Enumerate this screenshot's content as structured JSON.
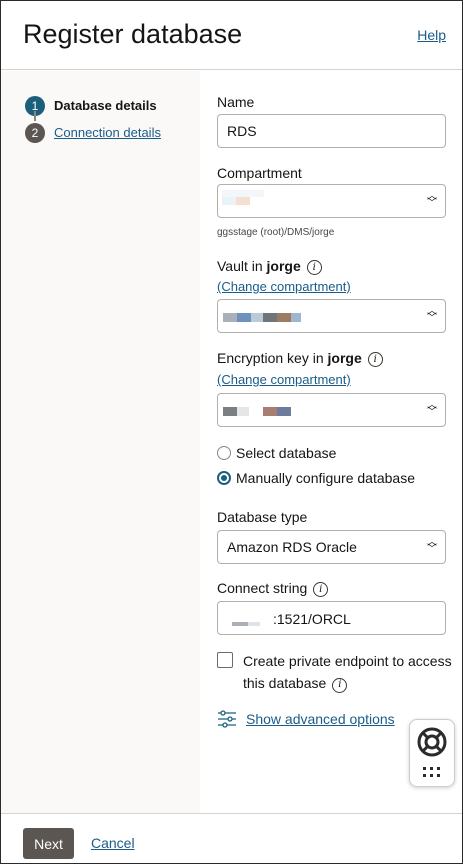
{
  "header": {
    "title": "Register database",
    "help_label": "Help"
  },
  "steps": [
    {
      "number": "1",
      "label": "Database details",
      "state": "active"
    },
    {
      "number": "2",
      "label": "Connection details",
      "state": "inactive"
    }
  ],
  "form": {
    "name": {
      "label": "Name",
      "value": "RDS"
    },
    "compartment": {
      "label": "Compartment",
      "hint": "ggsstage (root)/DMS/jorge"
    },
    "vault": {
      "label_prefix": "Vault in ",
      "label_bold": "jorge",
      "change_label": "(Change compartment)"
    },
    "encryption_key": {
      "label_prefix": "Encryption key in ",
      "label_bold": "jorge",
      "change_label": "(Change compartment)"
    },
    "database_mode": {
      "options": [
        {
          "label": "Select database",
          "checked": false
        },
        {
          "label": "Manually configure database",
          "checked": true
        }
      ]
    },
    "database_type": {
      "label": "Database type",
      "value": "Amazon RDS Oracle"
    },
    "connect_string": {
      "label": "Connect string",
      "value_suffix": ":1521/ORCL"
    },
    "private_endpoint": {
      "label": "Create private endpoint to access this database",
      "checked": false
    },
    "advanced_label": "Show advanced options"
  },
  "footer": {
    "next_label": "Next",
    "cancel_label": "Cancel"
  },
  "colors": {
    "accent": "#1b5f7c",
    "link": "#1a5c8a",
    "button_bg": "#5b5652"
  },
  "icons": {
    "info": "info-icon",
    "select_arrows": "chevron-up-down-icon",
    "advanced": "sliders-icon",
    "help_widget": "lifebuoy-icon",
    "apps_grid": "grid-icon"
  }
}
